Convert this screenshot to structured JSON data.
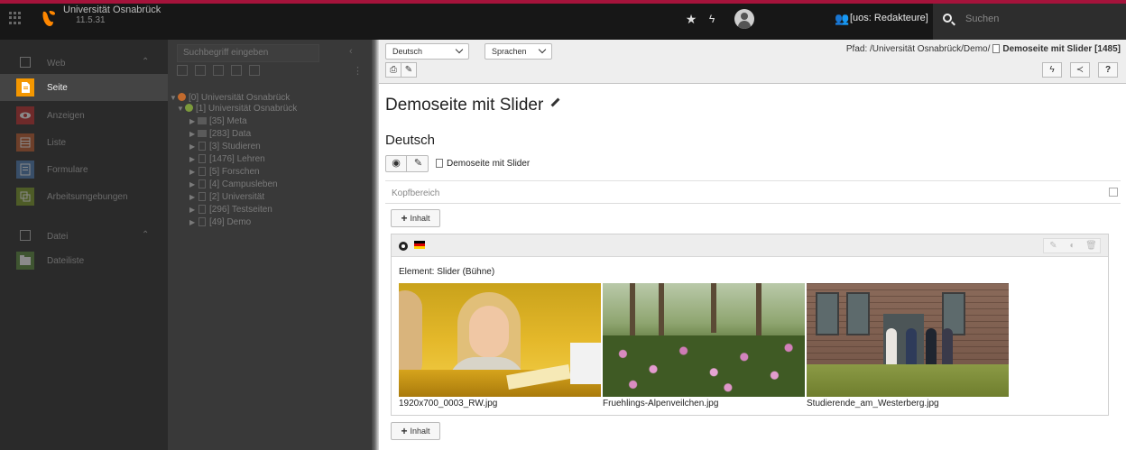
{
  "topbar": {
    "site_name": "Universität Osnabrück",
    "site_version": "11.5.31",
    "user_group": "[uos: Redakteure]",
    "search_placeholder": "Suchen",
    "accent_color": "#a5133b"
  },
  "modules": {
    "web_section": "Web",
    "items": [
      {
        "label": "Seite",
        "icon": "page-module-icon",
        "color": "#f49700",
        "active": true
      },
      {
        "label": "Anzeigen",
        "icon": "view-module-icon",
        "color": "#c12a2a",
        "active": false
      },
      {
        "label": "Liste",
        "icon": "list-module-icon",
        "color": "#c05a2a",
        "active": false
      },
      {
        "label": "Formulare",
        "icon": "form-module-icon",
        "color": "#4a7ab4",
        "active": false
      },
      {
        "label": "Arbeitsumgebungen",
        "icon": "workspaces-module-icon",
        "color": "#7a9a25",
        "active": false
      }
    ],
    "file_section": "Datei",
    "file_items": [
      {
        "label": "Dateiliste",
        "icon": "filelist-module-icon",
        "color": "#5a8a3a"
      }
    ]
  },
  "tree": {
    "search_placeholder": "Suchbegriff eingeben",
    "nodes": [
      {
        "label": "[0] Universität Osnabrück"
      },
      {
        "label": "[1] Universität Osnabrück"
      },
      {
        "label": "[35] Meta"
      },
      {
        "label": "[283] Data"
      },
      {
        "label": "[3] Studieren"
      },
      {
        "label": "[1476] Lehren"
      },
      {
        "label": "[5] Forschen"
      },
      {
        "label": "[4] Campusleben"
      },
      {
        "label": "[2] Universität"
      },
      {
        "label": "[296] Testseiten"
      },
      {
        "label": "[49] Demo"
      }
    ]
  },
  "docheader": {
    "language_select": "Deutsch",
    "languages_select": "Sprachen",
    "path_label": "Pfad: /Universität Osnabrück/Demo/",
    "path_page": "Demoseite mit Slider [1485]",
    "help_label": "?"
  },
  "page": {
    "title": "Demoseite mit Slider",
    "language_heading": "Deutsch",
    "page_link": "Demoseite mit Slider",
    "column_label": "Kopfbereich",
    "add_content_label": "Inhalt",
    "element_type": "Element: Slider (Bühne)",
    "images": [
      {
        "caption": "1920x700_0003_RW.jpg"
      },
      {
        "caption": "Fruehlings-Alpenveilchen.jpg"
      },
      {
        "caption": "Studierende_am_Westerberg.jpg"
      }
    ]
  }
}
